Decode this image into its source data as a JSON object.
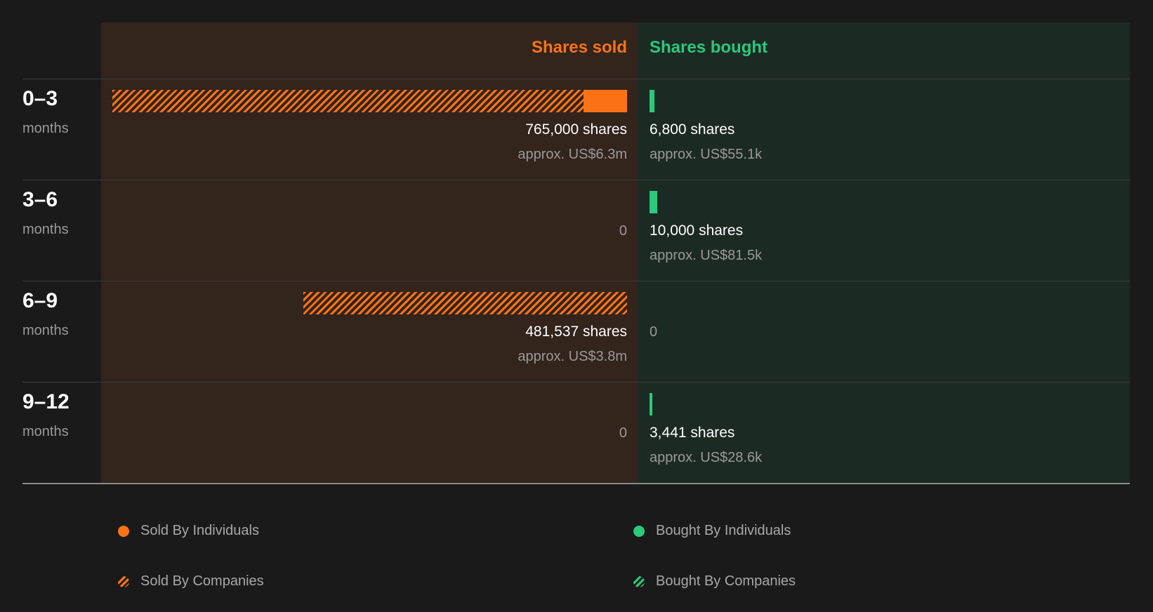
{
  "chart_data": {
    "type": "bar",
    "headers": {
      "sold": "Shares sold",
      "bought": "Shares bought"
    },
    "colors": {
      "sold": "#f97316",
      "bought": "#2bc97a",
      "background": "#1a1a1a"
    },
    "max_shares": 765000,
    "rows": [
      {
        "range": "0–3",
        "unit": "months",
        "sold": {
          "individuals": 65000,
          "companies": 700000,
          "shares_label": "765,000 shares",
          "approx_label": "approx. US$6.3m"
        },
        "bought": {
          "individuals": 6800,
          "companies": 0,
          "shares_label": "6,800 shares",
          "approx_label": "approx. US$55.1k"
        }
      },
      {
        "range": "3–6",
        "unit": "months",
        "sold": {
          "individuals": 0,
          "companies": 0,
          "zero_label": "0"
        },
        "bought": {
          "individuals": 10000,
          "companies": 0,
          "shares_label": "10,000 shares",
          "approx_label": "approx. US$81.5k"
        }
      },
      {
        "range": "6–9",
        "unit": "months",
        "sold": {
          "individuals": 0,
          "companies": 481537,
          "shares_label": "481,537 shares",
          "approx_label": "approx. US$3.8m"
        },
        "bought": {
          "individuals": 0,
          "companies": 0,
          "zero_label": "0"
        }
      },
      {
        "range": "9–12",
        "unit": "months",
        "sold": {
          "individuals": 0,
          "companies": 0,
          "zero_label": "0"
        },
        "bought": {
          "individuals": 3441,
          "companies": 0,
          "shares_label": "3,441 shares",
          "approx_label": "approx. US$28.6k"
        }
      }
    ],
    "legend": [
      {
        "label": "Sold By Individuals",
        "style": "solid",
        "color": "#f97316"
      },
      {
        "label": "Sold By Companies",
        "style": "hatched",
        "color": "#f97316"
      },
      {
        "label": "Bought By Individuals",
        "style": "solid",
        "color": "#2bc97a"
      },
      {
        "label": "Bought By Companies",
        "style": "hatched",
        "color": "#2bc97a"
      }
    ]
  }
}
